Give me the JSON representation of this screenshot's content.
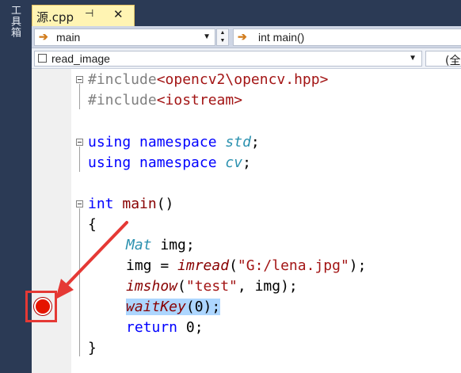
{
  "toolbox": {
    "label": "工具箱"
  },
  "tab": {
    "title": "源.cpp",
    "pin_glyph": "⊣",
    "close_glyph": "✕"
  },
  "navbar": {
    "scope": "main",
    "function": "int main()"
  },
  "navbar2": {
    "member": "read_image",
    "right": "(全"
  },
  "code": {
    "l1_pre": "#include",
    "l1_inc": "<opencv2\\opencv.hpp>",
    "l2_pre": "#include",
    "l2_inc": "<iostream>",
    "l3_kw": "using namespace",
    "l3_ns": "std",
    "l3_end": ";",
    "l4_kw": "using namespace",
    "l4_ns": "cv",
    "l4_end": ";",
    "l5_kw": "int",
    "l5_fn": "main",
    "l5_end": "()",
    "l6": "{",
    "l7_type": "Mat",
    "l7_rest": " img;",
    "l8_a": "img = ",
    "l8_fn": "imread",
    "l8_b": "(",
    "l8_str": "\"G:/lena.jpg\"",
    "l8_c": ");",
    "l9_fn": "imshow",
    "l9_b": "(",
    "l9_str": "\"test\"",
    "l9_c": ", img);",
    "l10_fn": "waitKey",
    "l10_rest": "(0);",
    "l11_kw": "return",
    "l11_rest": " 0;",
    "l12": "}"
  },
  "colors": {
    "keyword": "#0000ff",
    "string": "#a31515",
    "type": "#2b91af",
    "function": "#880000",
    "highlight": "#add6ff",
    "breakpoint": "#e51400",
    "annotation": "#e53935"
  }
}
